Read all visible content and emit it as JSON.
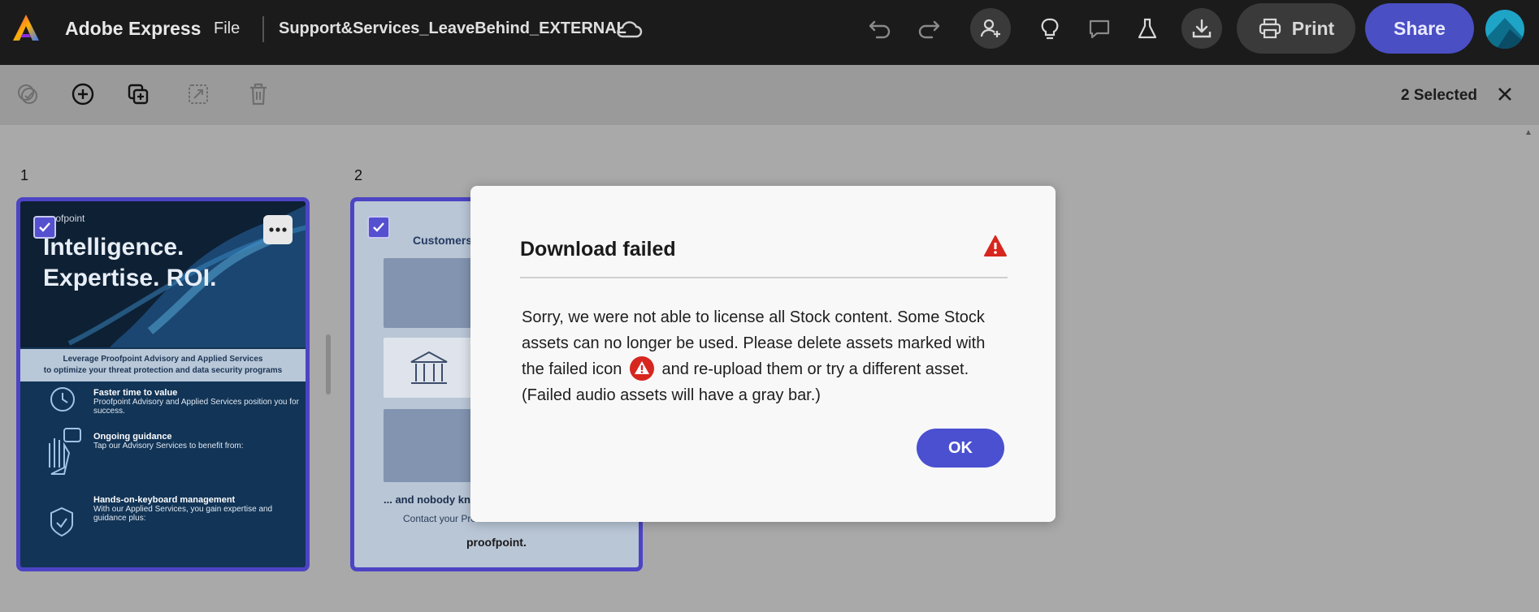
{
  "app": {
    "name": "Adobe Express",
    "file_menu": "File",
    "document_title": "Support&Services_LeaveBehind_EXTERNAL",
    "print_label": "Print",
    "share_label": "Share"
  },
  "toolbar": {
    "selected_count": "2 Selected"
  },
  "pages": [
    {
      "number": "1",
      "brand": "proofpoint",
      "title_line1": "Intelligence.",
      "title_line2": "Expertise. ROI.",
      "band_line1": "Leverage Proofpoint Advisory and Applied Services",
      "band_line2": "to optimize your threat protection and data security programs",
      "sections": [
        {
          "heading": "Faster time to value",
          "text": "Proofpoint Advisory and Applied Services position you for success."
        },
        {
          "heading": "Ongoing guidance",
          "text": "Tap our Advisory Services to benefit from:"
        },
        {
          "heading": "Hands-on-keyboard management",
          "text": "With our Applied Services, you gain expertise and guidance plus:"
        }
      ]
    },
    {
      "number": "2",
      "heading": "Customers of a",
      "footer": "... and nobody knows Pr",
      "contact": "Contact your Proo",
      "brand": "proofpoint."
    }
  ],
  "dialog": {
    "title": "Download failed",
    "body_part1": "Sorry, we were not able to license all Stock content. Some Stock assets can no longer be used. Please delete assets marked with the failed icon",
    "body_part2": "and re-upload them or try a different asset. (Failed audio assets will have a gray bar.)",
    "ok_label": "OK"
  },
  "colors": {
    "topbar": "#1b1b1b",
    "share_accent": "#4a4fc4",
    "selection_border": "#4c44c4",
    "warning_red": "#d7261e"
  },
  "icons": [
    "adobe-express-logo",
    "cloud-icon",
    "undo-icon",
    "redo-icon",
    "invite-icon",
    "lightbulb-icon",
    "comment-icon",
    "flask-icon",
    "download-icon",
    "print-icon",
    "warning-icon"
  ]
}
